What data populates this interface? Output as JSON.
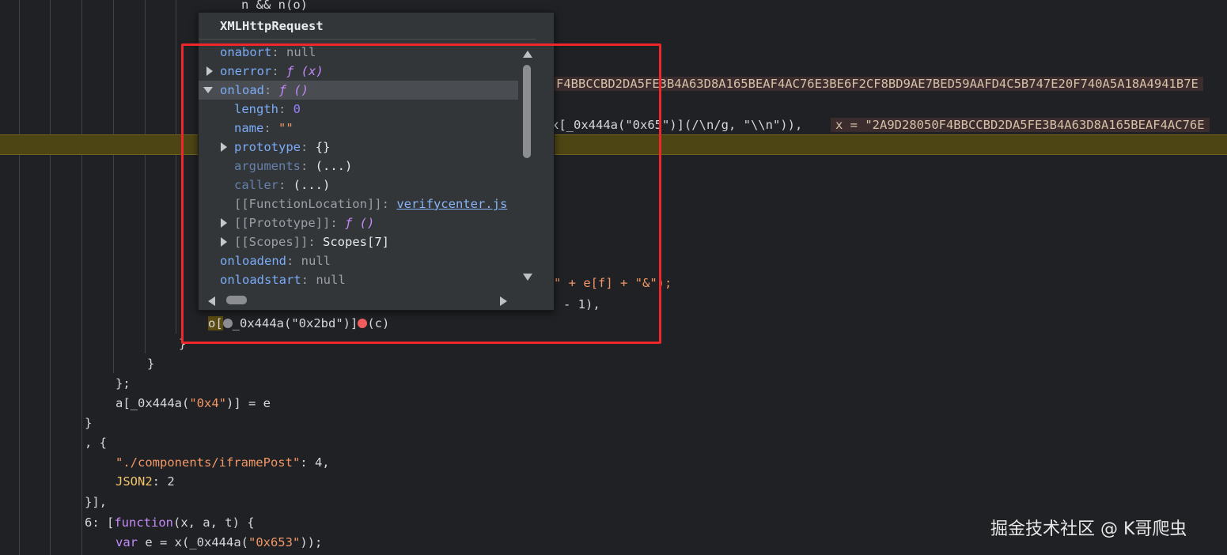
{
  "code": {
    "line_top": "n && n(o)",
    "inline_hex_value": "F4BBCCBD2DA5FE3B4A63D8A165BEAF4AC76E3BE6F2CF8BD9AE7BED59AAFD4C5B747E20F740A5A18A4941B7E",
    "hl_part1": "x[_0x444a(\"0x65\")](/\\n/g, \"\\\\n\")),",
    "hl_inline": "x = \"2A9D28050F4BBCCBD2DA5FE3B4A63D8A165BEAF4AC76E",
    "l_ef": "\" + e[f] + \"&\");",
    "l_minus": "- 1),",
    "l_call_a": "o[",
    "l_call_b": "_0x444a(\"0x2bd\")]",
    "l_call_c": "(c)",
    "brace1": "}",
    "brace2": "}",
    "semi": "};",
    "assign_a": "a[",
    "assign_fn": "_0x444a(",
    "assign_str": "\"0x4\"",
    "assign_rest": ")] = e",
    "brace3": "}",
    "comma_open": ", {",
    "obj_key1": "\"./components/iframePost\"",
    "obj_val1": ": 4,",
    "obj_key2": "JSON2",
    "obj_val2": ": 2",
    "close_arr": "}],",
    "fn_idx": "6: [",
    "fn_kw": "function",
    "fn_params": "(x, a, t) {",
    "var_kw": "var",
    "var_rest_a": " e = x(_0x444a(",
    "var_str": "\"0x653\"",
    "var_rest_b": "));"
  },
  "popover": {
    "title": "XMLHttpRequest",
    "rows": [
      {
        "key": "onabort",
        "sep": ": ",
        "val": "null"
      },
      {
        "key": "onerror",
        "sep": ": ",
        "val": "ƒ (x)"
      },
      {
        "key": "onload",
        "sep": ": ",
        "val": "ƒ ()"
      },
      {
        "key": "length",
        "sep": ": ",
        "val": "0"
      },
      {
        "key": "name",
        "sep": ": ",
        "val": "\"\""
      },
      {
        "key": "prototype",
        "sep": ": ",
        "val": "{}"
      },
      {
        "key": "arguments",
        "sep": ": ",
        "val": "(...)"
      },
      {
        "key": "caller",
        "sep": ": ",
        "val": "(...)"
      },
      {
        "key": "[[FunctionLocation]]",
        "sep": ": ",
        "val": "verifycenter.js"
      },
      {
        "key": "[[Prototype]]",
        "sep": ": ",
        "val": "ƒ ()"
      },
      {
        "key": "[[Scopes]]",
        "sep": ": ",
        "val": "Scopes[7]"
      },
      {
        "key": "onloadend",
        "sep": ": ",
        "val": "null"
      },
      {
        "key": "onloadstart",
        "sep": ": ",
        "val": "null"
      }
    ]
  },
  "watermark": "掘金技术社区 @ K哥爬虫",
  "colors": {
    "highlight": "#4d4513",
    "red_box": "#f0272a",
    "breakpoint": "#f15c5c"
  }
}
